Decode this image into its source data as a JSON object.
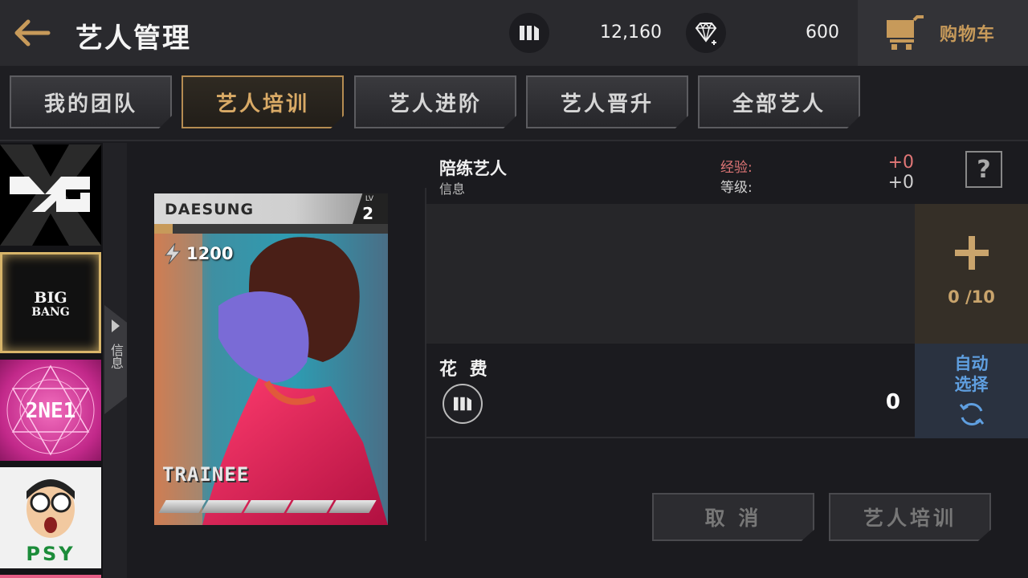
{
  "header": {
    "title": "艺人管理",
    "coin_value": "12,160",
    "gem_value": "600",
    "cart_label": "购物车"
  },
  "tabs": [
    {
      "label": "我的团队",
      "active": false
    },
    {
      "label": "艺人培训",
      "active": true
    },
    {
      "label": "艺人进阶",
      "active": false
    },
    {
      "label": "艺人晋升",
      "active": false
    },
    {
      "label": "全部艺人",
      "active": false
    }
  ],
  "sidebar": {
    "groups": [
      "YG",
      "BIGBANG",
      "2NE1",
      "PSY"
    ],
    "selected": "BIGBANG",
    "info_tab_label": "信息"
  },
  "card": {
    "name": "DAESUNG",
    "level_label": "LV",
    "level": "2",
    "power": "1200",
    "rank": "TRAINEE",
    "exp_fraction": 0.08,
    "stars_total": 5
  },
  "panel": {
    "title": "陪练艺人",
    "subtitle": "信息",
    "exp_label": "经验:",
    "exp_value": "+0",
    "level_label": "等级:",
    "level_value": "+0",
    "help_label": "?",
    "slot_count": "0 /10",
    "cost_label": "花 费",
    "cost_value": "0",
    "auto_label": "自动选择"
  },
  "buttons": {
    "cancel": "取 消",
    "train": "艺人培训"
  },
  "colors": {
    "accent_gold": "#c79a5a",
    "auto_blue": "#5f9fe0",
    "exp_red": "#e07676"
  }
}
